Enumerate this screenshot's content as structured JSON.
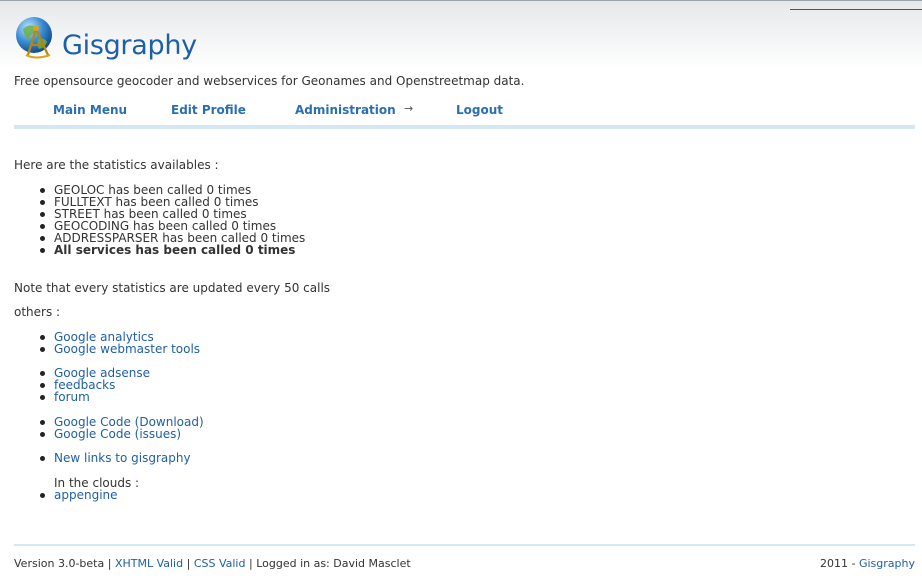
{
  "header": {
    "title": "Gisgraphy",
    "tagline": "Free opensource geocoder and webservices for Geonames and Openstreetmap data."
  },
  "nav": {
    "items": [
      {
        "label": "Main Menu"
      },
      {
        "label": "Edit Profile"
      },
      {
        "label": "Administration"
      },
      {
        "label": "Logout"
      }
    ],
    "arrow": "→"
  },
  "main": {
    "intro": "Here are the statistics availables :",
    "stats": [
      "GEOLOC has been called 0 times",
      "FULLTEXT has been called 0 times",
      "STREET has been called 0 times",
      "GEOCODING has been called 0 times",
      "ADDRESSPARSER has been called 0 times",
      "All services has been called 0 times"
    ],
    "note": "Note that every statistics are updated every 50 calls",
    "others_label": "others :",
    "links_group1": [
      "Google analytics",
      "Google webmaster tools"
    ],
    "links_group2": [
      "Google adsense",
      "feedbacks",
      "forum"
    ],
    "links_group3": [
      "Google Code (Download)",
      "Google Code (issues)"
    ],
    "links_group4": [
      "New links to gisgraphy"
    ],
    "clouds_label": "In the clouds :",
    "clouds_link": "appengine"
  },
  "footer": {
    "version": "Version 3.0-beta",
    "xhtml": "XHTML Valid",
    "css": "CSS Valid",
    "logged_in": "Logged in as: David Masclet",
    "separator": "|",
    "year": "2011 -",
    "brand": "Gisgraphy"
  },
  "colors": {
    "link": "#1f5fa6",
    "nav_underline": "#d5e7f2"
  },
  "icons": [
    "globe-logo-icon",
    "arrow-right-icon"
  ]
}
